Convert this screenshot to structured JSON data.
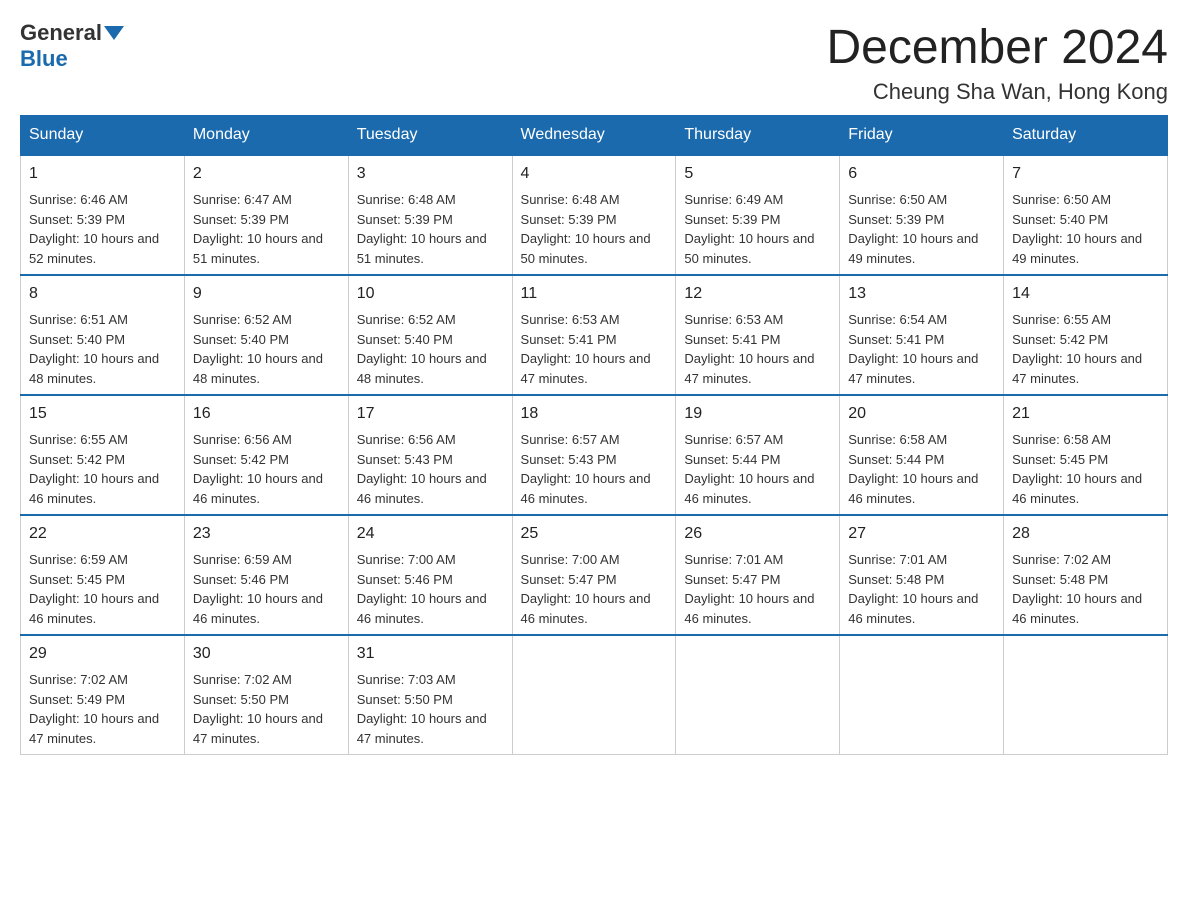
{
  "logo": {
    "general": "General",
    "blue": "Blue"
  },
  "header": {
    "month_title": "December 2024",
    "location": "Cheung Sha Wan, Hong Kong"
  },
  "weekdays": [
    "Sunday",
    "Monday",
    "Tuesday",
    "Wednesday",
    "Thursday",
    "Friday",
    "Saturday"
  ],
  "weeks": [
    [
      {
        "day": "1",
        "sunrise": "6:46 AM",
        "sunset": "5:39 PM",
        "daylight": "10 hours and 52 minutes."
      },
      {
        "day": "2",
        "sunrise": "6:47 AM",
        "sunset": "5:39 PM",
        "daylight": "10 hours and 51 minutes."
      },
      {
        "day": "3",
        "sunrise": "6:48 AM",
        "sunset": "5:39 PM",
        "daylight": "10 hours and 51 minutes."
      },
      {
        "day": "4",
        "sunrise": "6:48 AM",
        "sunset": "5:39 PM",
        "daylight": "10 hours and 50 minutes."
      },
      {
        "day": "5",
        "sunrise": "6:49 AM",
        "sunset": "5:39 PM",
        "daylight": "10 hours and 50 minutes."
      },
      {
        "day": "6",
        "sunrise": "6:50 AM",
        "sunset": "5:39 PM",
        "daylight": "10 hours and 49 minutes."
      },
      {
        "day": "7",
        "sunrise": "6:50 AM",
        "sunset": "5:40 PM",
        "daylight": "10 hours and 49 minutes."
      }
    ],
    [
      {
        "day": "8",
        "sunrise": "6:51 AM",
        "sunset": "5:40 PM",
        "daylight": "10 hours and 48 minutes."
      },
      {
        "day": "9",
        "sunrise": "6:52 AM",
        "sunset": "5:40 PM",
        "daylight": "10 hours and 48 minutes."
      },
      {
        "day": "10",
        "sunrise": "6:52 AM",
        "sunset": "5:40 PM",
        "daylight": "10 hours and 48 minutes."
      },
      {
        "day": "11",
        "sunrise": "6:53 AM",
        "sunset": "5:41 PM",
        "daylight": "10 hours and 47 minutes."
      },
      {
        "day": "12",
        "sunrise": "6:53 AM",
        "sunset": "5:41 PM",
        "daylight": "10 hours and 47 minutes."
      },
      {
        "day": "13",
        "sunrise": "6:54 AM",
        "sunset": "5:41 PM",
        "daylight": "10 hours and 47 minutes."
      },
      {
        "day": "14",
        "sunrise": "6:55 AM",
        "sunset": "5:42 PM",
        "daylight": "10 hours and 47 minutes."
      }
    ],
    [
      {
        "day": "15",
        "sunrise": "6:55 AM",
        "sunset": "5:42 PM",
        "daylight": "10 hours and 46 minutes."
      },
      {
        "day": "16",
        "sunrise": "6:56 AM",
        "sunset": "5:42 PM",
        "daylight": "10 hours and 46 minutes."
      },
      {
        "day": "17",
        "sunrise": "6:56 AM",
        "sunset": "5:43 PM",
        "daylight": "10 hours and 46 minutes."
      },
      {
        "day": "18",
        "sunrise": "6:57 AM",
        "sunset": "5:43 PM",
        "daylight": "10 hours and 46 minutes."
      },
      {
        "day": "19",
        "sunrise": "6:57 AM",
        "sunset": "5:44 PM",
        "daylight": "10 hours and 46 minutes."
      },
      {
        "day": "20",
        "sunrise": "6:58 AM",
        "sunset": "5:44 PM",
        "daylight": "10 hours and 46 minutes."
      },
      {
        "day": "21",
        "sunrise": "6:58 AM",
        "sunset": "5:45 PM",
        "daylight": "10 hours and 46 minutes."
      }
    ],
    [
      {
        "day": "22",
        "sunrise": "6:59 AM",
        "sunset": "5:45 PM",
        "daylight": "10 hours and 46 minutes."
      },
      {
        "day": "23",
        "sunrise": "6:59 AM",
        "sunset": "5:46 PM",
        "daylight": "10 hours and 46 minutes."
      },
      {
        "day": "24",
        "sunrise": "7:00 AM",
        "sunset": "5:46 PM",
        "daylight": "10 hours and 46 minutes."
      },
      {
        "day": "25",
        "sunrise": "7:00 AM",
        "sunset": "5:47 PM",
        "daylight": "10 hours and 46 minutes."
      },
      {
        "day": "26",
        "sunrise": "7:01 AM",
        "sunset": "5:47 PM",
        "daylight": "10 hours and 46 minutes."
      },
      {
        "day": "27",
        "sunrise": "7:01 AM",
        "sunset": "5:48 PM",
        "daylight": "10 hours and 46 minutes."
      },
      {
        "day": "28",
        "sunrise": "7:02 AM",
        "sunset": "5:48 PM",
        "daylight": "10 hours and 46 minutes."
      }
    ],
    [
      {
        "day": "29",
        "sunrise": "7:02 AM",
        "sunset": "5:49 PM",
        "daylight": "10 hours and 47 minutes."
      },
      {
        "day": "30",
        "sunrise": "7:02 AM",
        "sunset": "5:50 PM",
        "daylight": "10 hours and 47 minutes."
      },
      {
        "day": "31",
        "sunrise": "7:03 AM",
        "sunset": "5:50 PM",
        "daylight": "10 hours and 47 minutes."
      },
      null,
      null,
      null,
      null
    ]
  ]
}
